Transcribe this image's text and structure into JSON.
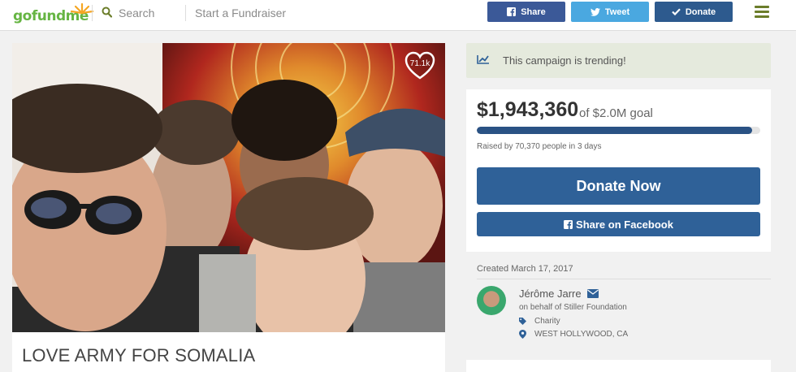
{
  "header": {
    "logo": "gofundme",
    "search_label": "Search",
    "start_label": "Start a Fundraiser",
    "share_label": "Share",
    "tweet_label": "Tweet",
    "donate_label": "Donate"
  },
  "campaign": {
    "title": "LOVE ARMY FOR SOMALIA",
    "likes": "71.1k",
    "trending": "This campaign is trending!",
    "raised": "$1,943,360",
    "goal": "of $2.0M goal",
    "progress_fraction": 0.97,
    "raised_by": "Raised by 70,370 people in 3 days",
    "donate_now": "Donate Now",
    "share_facebook": "Share on Facebook",
    "created": "Created March 17, 2017",
    "organizer": "Jérôme Jarre",
    "behalf": "on behalf of Stiller Foundation",
    "category": "Charity",
    "location": "WEST HOLLYWOOD, CA"
  },
  "colors": {
    "brand_green": "#66b543",
    "facebook_blue": "#3b5998",
    "twitter_blue": "#4aa8e0",
    "donate_blue": "#2f6198",
    "trend_bg": "#e5eadd"
  }
}
